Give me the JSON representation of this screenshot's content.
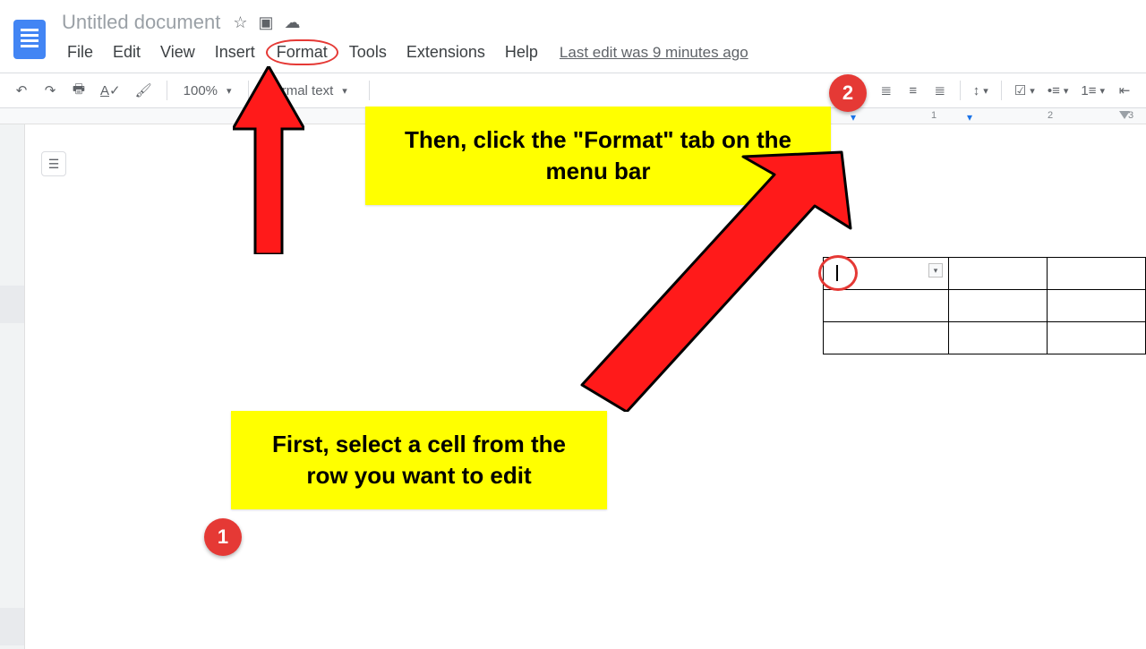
{
  "app": {
    "title": "Untitled document",
    "last_edit": "Last edit was 9 minutes ago"
  },
  "menu": {
    "file": "File",
    "edit": "Edit",
    "view": "View",
    "insert": "Insert",
    "format": "Format",
    "tools": "Tools",
    "extensions": "Extensions",
    "help": "Help"
  },
  "toolbar": {
    "zoom": "100%",
    "style": "Normal text"
  },
  "ruler": {
    "n1": "1",
    "n2": "2",
    "n3": "3"
  },
  "annotations": {
    "step2_text": "Then, click the \"Format\" tab on the menu bar",
    "step1_text": "First, select a cell from the row you want to edit",
    "badge1": "1",
    "badge2": "2"
  }
}
